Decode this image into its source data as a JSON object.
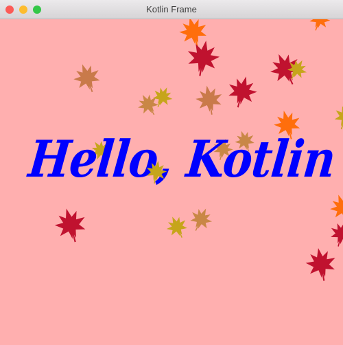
{
  "window": {
    "title": "Kotlin Frame",
    "background_color": "#ffafaf"
  },
  "traffic_lights": {
    "close_color": "#fc5b57",
    "minimize_color": "#fdbc2e",
    "zoom_color": "#33c748"
  },
  "canvas": {
    "text": "Hello, Kotlin",
    "text_color": "#0000ff"
  },
  "leaf_colors": {
    "crimson": "#c0122f",
    "orange": "#ff6e0c",
    "brown": "#c97a4a",
    "olive": "#c6a51b",
    "tan": "#c98746"
  }
}
